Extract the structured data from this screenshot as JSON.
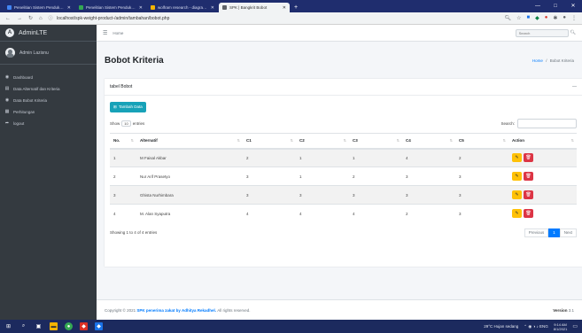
{
  "browser": {
    "tabs": [
      {
        "title": "Penelitian Sistem Pendukung Kep",
        "color": "#4285f4",
        "active": false
      },
      {
        "title": "Penelitian Sistem Pendukung Ke",
        "color": "#34a853",
        "active": false
      },
      {
        "title": "wolfram research - diagrams net",
        "color": "#f4b400",
        "active": false
      },
      {
        "title": "SPK | Bangkrit Bobot",
        "color": "#5f6368",
        "active": true
      }
    ],
    "new_tab": "+",
    "url": "localhost/spk-weight-product-/admin/tambahan/bobot.php",
    "window_controls": [
      "—",
      "□",
      "✕"
    ]
  },
  "sidebar": {
    "brand": "AdminLTE",
    "logo_letter": "A",
    "user_name": "Admin Lazisnu",
    "menu": [
      {
        "icon": "◉",
        "label": "Dashboard"
      },
      {
        "icon": "▤",
        "label": "Data Alternatif dan Kriteria"
      },
      {
        "icon": "◉",
        "label": "Data Bobot Kriteria"
      },
      {
        "icon": "▦",
        "label": "Perhitungan"
      },
      {
        "icon": "➦",
        "label": "logout"
      }
    ]
  },
  "topnav": {
    "home": "Home",
    "search_placeholder": "Search"
  },
  "header": {
    "title": "Bobot Kriteria",
    "breadcrumb_home": "Home",
    "breadcrumb_sep": "/",
    "breadcrumb_current": "Bobot Kriteria"
  },
  "card": {
    "title": "tabel Bobot",
    "add_button": "Tambah Data",
    "show_label": "Show",
    "entries_value": "10",
    "entries_label": "entries",
    "search_label": "Search:",
    "columns": [
      "No.",
      "Alternatif",
      "C1",
      "C2",
      "C3",
      "C4",
      "C5",
      "Action"
    ],
    "rows": [
      {
        "no": "1",
        "alternatif": "M Faisal Akbar",
        "c1": "2",
        "c2": "1",
        "c3": "1",
        "c4": "4",
        "c5": "2"
      },
      {
        "no": "2",
        "alternatif": "Nur Arif Prasetyo",
        "c1": "3",
        "c2": "1",
        "c3": "2",
        "c4": "3",
        "c5": "3"
      },
      {
        "no": "3",
        "alternatif": "Ghista Nurhimbara",
        "c1": "3",
        "c2": "3",
        "c3": "3",
        "c4": "3",
        "c5": "3"
      },
      {
        "no": "4",
        "alternatif": "M. Alan Syaputra",
        "c1": "4",
        "c2": "4",
        "c3": "4",
        "c4": "2",
        "c5": "3"
      }
    ],
    "info": "Showing 1 to 4 of 4 entries",
    "pager": {
      "previous": "Previous",
      "page": "1",
      "next": "Next"
    }
  },
  "footer": {
    "copyright": "Copyright © 2021",
    "brand": "SPK penerima zakat by Adhitya Rekadhel.",
    "rights": "All rights reserved.",
    "version_label": "Version",
    "version_value": "3.1"
  },
  "taskbar": {
    "weather": "29°C Hujan sedang",
    "lang": "ENG",
    "time": "9:14 AM",
    "date": "8/1/2021"
  }
}
